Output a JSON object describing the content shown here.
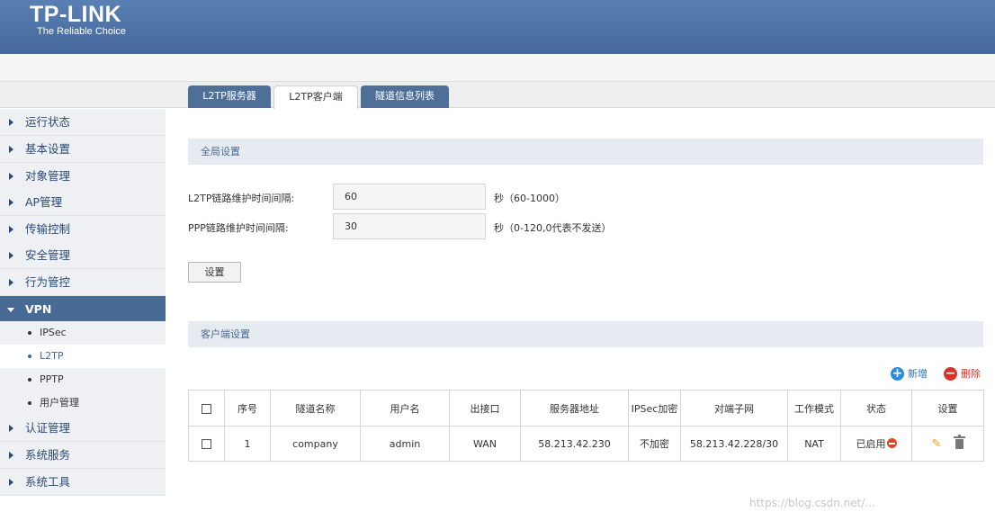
{
  "brand": {
    "logo_text": "TP-LINK",
    "tagline": "The Reliable Choice"
  },
  "tabs": [
    {
      "label": "L2TP服务器",
      "active": false
    },
    {
      "label": "L2TP客户端",
      "active": true
    },
    {
      "label": "隧道信息列表",
      "active": false
    }
  ],
  "sidebar": {
    "items": [
      {
        "label": "运行状态"
      },
      {
        "label": "基本设置"
      },
      {
        "label": "对象管理"
      },
      {
        "label": "AP管理"
      },
      {
        "label": "传输控制"
      },
      {
        "label": "安全管理"
      },
      {
        "label": "行为管控"
      },
      {
        "label": "VPN",
        "open": true
      },
      {
        "label": "认证管理"
      },
      {
        "label": "系统服务"
      },
      {
        "label": "系统工具"
      }
    ],
    "vpn_subitems": [
      {
        "label": "IPSec"
      },
      {
        "label": "L2TP",
        "selected": true
      },
      {
        "label": "PPTP"
      },
      {
        "label": "用户管理"
      }
    ]
  },
  "global_settings": {
    "title": "全局设置",
    "l2tp_interval": {
      "label": "L2TP链路维护时间间隔:",
      "value": "60",
      "hint": "秒（60-1000）"
    },
    "ppp_interval": {
      "label": "PPP链路维护时间间隔:",
      "value": "30",
      "hint": "秒（0-120,0代表不发送）"
    },
    "save_button": "设置"
  },
  "client_settings": {
    "title": "客户端设置",
    "add_label": "新增",
    "delete_label": "删除",
    "columns": [
      "序号",
      "隧道名称",
      "用户名",
      "出接口",
      "服务器地址",
      "IPSec加密",
      "对端子网",
      "工作模式",
      "状态",
      "设置"
    ],
    "rows": [
      {
        "index": "1",
        "tunnel_name": "company",
        "username": "admin",
        "interface": "WAN",
        "server": "58.213.42.230",
        "ipsec": "不加密",
        "peer_subnet": "58.213.42.228/30",
        "mode": "NAT",
        "status": "已启用"
      }
    ]
  },
  "colors": {
    "header": "#4f74a8",
    "accent": "#4a6a96",
    "add": "#2a8bd8",
    "delete": "#d8322a"
  },
  "watermark": "https://blog.csdn.net/..."
}
